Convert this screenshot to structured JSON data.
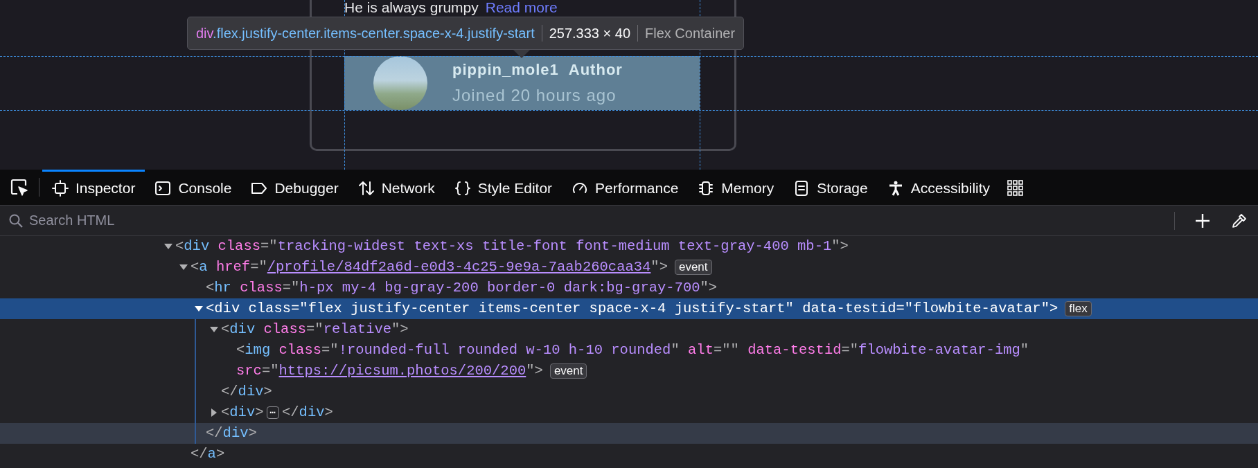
{
  "page_preview": {
    "card_text": "He is always grumpy",
    "read_more_link": "Read more",
    "author": {
      "name": "pippin_mole1",
      "role": "Author",
      "joined": "Joined 20 hours ago"
    }
  },
  "highlighter_tooltip": {
    "tag": "div",
    "classes": ".flex.justify-center.items-center.space-x-4.justify-start",
    "size": "257.333 × 40",
    "type": "Flex Container"
  },
  "toolbar": {
    "tabs": [
      {
        "label": "Inspector",
        "selected": true
      },
      {
        "label": "Console",
        "selected": false
      },
      {
        "label": "Debugger",
        "selected": false
      },
      {
        "label": "Network",
        "selected": false
      },
      {
        "label": "Style Editor",
        "selected": false
      },
      {
        "label": "Performance",
        "selected": false
      },
      {
        "label": "Memory",
        "selected": false
      },
      {
        "label": "Storage",
        "selected": false
      },
      {
        "label": "Accessibility",
        "selected": false
      }
    ]
  },
  "search": {
    "placeholder": "Search HTML"
  },
  "markup_tree": [
    {
      "line": [
        {
          "kind": "punct",
          "text": "<"
        },
        {
          "kind": "tag",
          "text": "div"
        },
        {
          "kind": "attr",
          "text": " class"
        },
        {
          "kind": "punct",
          "text": "=\""
        },
        {
          "kind": "value",
          "text": "tracking-widest text-xs title-font font-medium text-gray-400 mb-1"
        },
        {
          "kind": "punct",
          "text": "\">"
        }
      ],
      "expanded": true,
      "selected": false,
      "children": [
        {
          "line": [
            {
              "kind": "punct",
              "text": "<"
            },
            {
              "kind": "tag",
              "text": "a"
            },
            {
              "kind": "attr",
              "text": " href"
            },
            {
              "kind": "punct",
              "text": "=\""
            },
            {
              "kind": "link",
              "text": "/profile/84df2a6d-e0d3-4c25-9e9a-7aab260caa34"
            },
            {
              "kind": "punct",
              "text": "\">"
            },
            {
              "kind": "badge",
              "text": "event"
            }
          ],
          "expanded": true,
          "selected": false,
          "closing": [
            {
              "kind": "punct",
              "text": "</"
            },
            {
              "kind": "tag",
              "text": "a"
            },
            {
              "kind": "punct",
              "text": ">"
            }
          ],
          "closing_hovered": false,
          "children": [
            {
              "line": [
                {
                  "kind": "punct",
                  "text": "<"
                },
                {
                  "kind": "tag",
                  "text": "hr"
                },
                {
                  "kind": "attr",
                  "text": " class"
                },
                {
                  "kind": "punct",
                  "text": "=\""
                },
                {
                  "kind": "value",
                  "text": "h-px my-4 bg-gray-200 border-0 dark:bg-gray-700"
                },
                {
                  "kind": "punct",
                  "text": "\">"
                }
              ],
              "selected": false
            },
            {
              "line": [
                {
                  "kind": "punct",
                  "text": "<"
                },
                {
                  "kind": "tag",
                  "text": "div"
                },
                {
                  "kind": "attr",
                  "text": " class"
                },
                {
                  "kind": "punct",
                  "text": "=\""
                },
                {
                  "kind": "value",
                  "text": "flex justify-center items-center space-x-4 justify-start"
                },
                {
                  "kind": "punct",
                  "text": "\""
                },
                {
                  "kind": "attr",
                  "text": " data-testid"
                },
                {
                  "kind": "punct",
                  "text": "=\""
                },
                {
                  "kind": "value",
                  "text": "flowbite-avatar"
                },
                {
                  "kind": "punct",
                  "text": "\">"
                },
                {
                  "kind": "badge",
                  "text": "flex"
                }
              ],
              "expanded": true,
              "selected": true,
              "closing": [
                {
                  "kind": "punct",
                  "text": "</"
                },
                {
                  "kind": "tag",
                  "text": "div"
                },
                {
                  "kind": "punct",
                  "text": ">"
                }
              ],
              "closing_hovered": true,
              "children": [
                {
                  "line": [
                    {
                      "kind": "punct",
                      "text": "<"
                    },
                    {
                      "kind": "tag",
                      "text": "div"
                    },
                    {
                      "kind": "attr",
                      "text": " class"
                    },
                    {
                      "kind": "punct",
                      "text": "=\""
                    },
                    {
                      "kind": "value",
                      "text": "relative"
                    },
                    {
                      "kind": "punct",
                      "text": "\">"
                    }
                  ],
                  "expanded": true,
                  "selected": false,
                  "closing": [
                    {
                      "kind": "punct",
                      "text": "</"
                    },
                    {
                      "kind": "tag",
                      "text": "div"
                    },
                    {
                      "kind": "punct",
                      "text": ">"
                    }
                  ],
                  "closing_hovered": false,
                  "children": [
                    {
                      "line": [
                        {
                          "kind": "punct",
                          "text": "<"
                        },
                        {
                          "kind": "tag",
                          "text": "img"
                        },
                        {
                          "kind": "attr",
                          "text": " class"
                        },
                        {
                          "kind": "punct",
                          "text": "=\""
                        },
                        {
                          "kind": "value",
                          "text": "!rounded-full rounded w-10 h-10 rounded"
                        },
                        {
                          "kind": "punct",
                          "text": "\""
                        },
                        {
                          "kind": "attr",
                          "text": " alt"
                        },
                        {
                          "kind": "punct",
                          "text": "=\"\""
                        },
                        {
                          "kind": "attr",
                          "text": " data-testid"
                        },
                        {
                          "kind": "punct",
                          "text": "=\""
                        },
                        {
                          "kind": "value",
                          "text": "flowbite-avatar-img"
                        },
                        {
                          "kind": "punct",
                          "text": "\""
                        },
                        {
                          "kind": "break"
                        },
                        {
                          "kind": "attr",
                          "text": "src"
                        },
                        {
                          "kind": "punct",
                          "text": "=\""
                        },
                        {
                          "kind": "link",
                          "text": "https://picsum.photos/200/200"
                        },
                        {
                          "kind": "punct",
                          "text": "\">"
                        },
                        {
                          "kind": "badge",
                          "text": "event"
                        }
                      ],
                      "selected": false
                    }
                  ]
                },
                {
                  "line": [
                    {
                      "kind": "punct",
                      "text": "<"
                    },
                    {
                      "kind": "tag",
                      "text": "div"
                    },
                    {
                      "kind": "punct",
                      "text": ">"
                    },
                    {
                      "kind": "more",
                      "text": "⋯"
                    },
                    {
                      "kind": "punct",
                      "text": "</"
                    },
                    {
                      "kind": "tag",
                      "text": "div"
                    },
                    {
                      "kind": "punct",
                      "text": ">"
                    }
                  ],
                  "expanded": false,
                  "selected": false
                }
              ]
            }
          ]
        }
      ]
    }
  ]
}
